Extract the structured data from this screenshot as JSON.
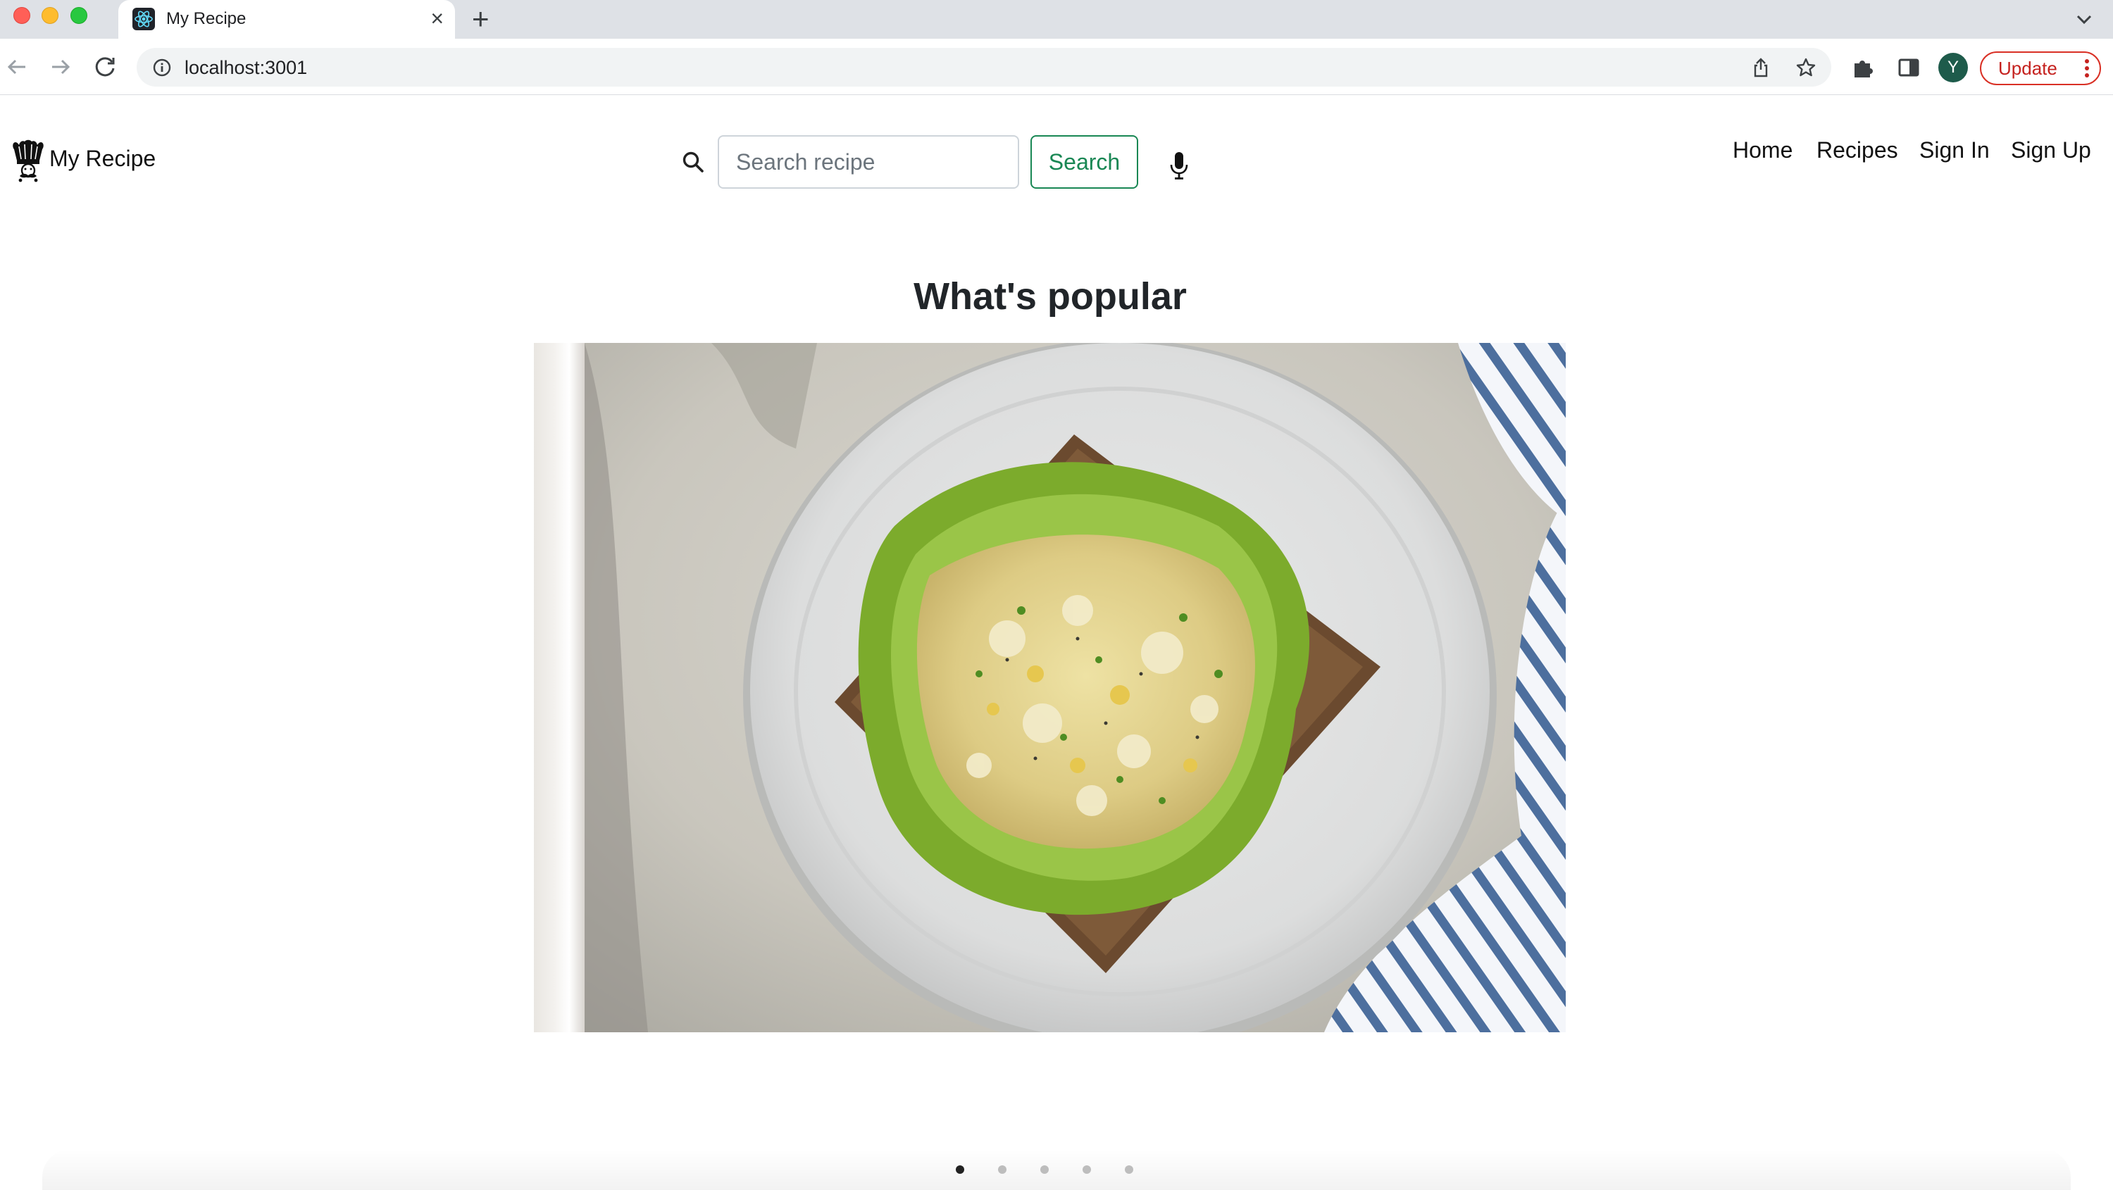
{
  "browser": {
    "tab_title": "My Recipe",
    "url": "localhost:3001",
    "profile_initial": "Y",
    "update_label": "Update"
  },
  "navbar": {
    "brand": "My Recipe",
    "search_placeholder": "Search recipe",
    "search_value": "",
    "search_button": "Search",
    "links": [
      "Home",
      "Recipes",
      "Sign In",
      "Sign Up"
    ]
  },
  "carousel": {
    "title": "What's popular",
    "slide_count": 5,
    "active_index": 0,
    "current_image": "egg-salad-sandwich-photo"
  },
  "colors": {
    "accent_green": "#198754",
    "update_red": "#d93025",
    "avatar_bg": "#1e5b4b"
  },
  "icons": [
    "search-icon",
    "microphone-icon",
    "chef-hat-logo",
    "back-icon",
    "forward-icon",
    "reload-icon",
    "info-icon",
    "share-icon",
    "star-icon",
    "extensions-icon",
    "side-panel-icon",
    "tab-search-icon"
  ]
}
